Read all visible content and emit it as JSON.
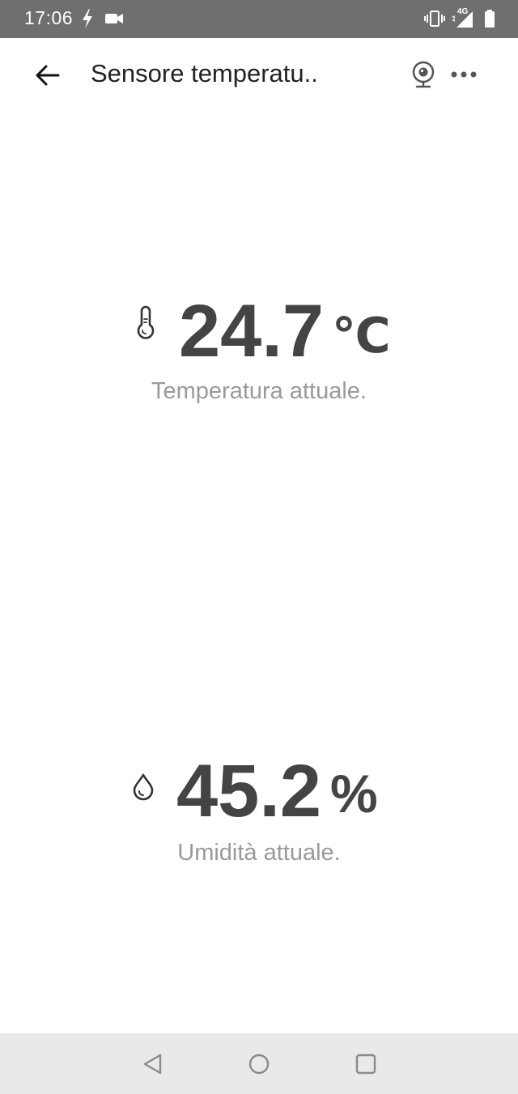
{
  "status_bar": {
    "time": "17:06",
    "network": "4G",
    "icons": [
      "flash-icon",
      "video-record-icon",
      "vibrate-icon",
      "signal-icon",
      "battery-icon"
    ]
  },
  "app_bar": {
    "title": "Sensore temperatu..",
    "back_icon": "back-arrow-icon",
    "camera_icon": "webcam-icon",
    "more_icon": "more-horizontal-icon"
  },
  "readings": {
    "temperature": {
      "value": "24.7",
      "unit": "℃",
      "label": "Temperatura attuale.",
      "icon": "thermometer-icon"
    },
    "humidity": {
      "value": "45.2",
      "unit": "%",
      "label": "Umidità attuale.",
      "icon": "water-drop-icon"
    }
  },
  "nav_bar": {
    "icons": [
      "nav-back-icon",
      "nav-home-icon",
      "nav-recents-icon"
    ]
  },
  "colors": {
    "status_bar_bg": "#6f6f6f",
    "value_text": "#444444",
    "label_text": "#9a9a9a",
    "nav_bar_bg": "#e9e9e9"
  }
}
